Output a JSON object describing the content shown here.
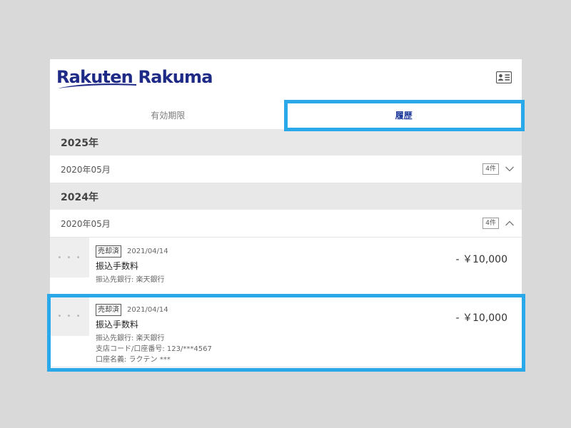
{
  "header": {
    "logo_text": "Rakuten Rakuma",
    "logo_brand_color": "#1e2a86",
    "id_card_icon": "id-card-icon"
  },
  "tabs": [
    {
      "label": "有効期限",
      "active": false
    },
    {
      "label": "履歴",
      "active": true
    }
  ],
  "groups": [
    {
      "year": "2025年",
      "months": [
        {
          "label": "2020年05月",
          "count": "4件",
          "expanded": false
        }
      ]
    },
    {
      "year": "2024年",
      "months": [
        {
          "label": "2020年05月",
          "count": "4件",
          "expanded": true,
          "items": [
            {
              "thumb": "• • •",
              "badge": "売却済",
              "date": "2021/04/14",
              "title": "振込手数料",
              "details": [
                "振込先銀行: 楽天銀行"
              ],
              "amount": "- ￥10,000"
            },
            {
              "thumb": "• • •",
              "badge": "売却済",
              "date": "2021/04/14",
              "title": "振込手数料",
              "details": [
                "振込先銀行: 楽天銀行",
                "支店コード/口座番号: 123/***4567",
                "口座名義: ラクテン ***"
              ],
              "amount": "- ￥10,000"
            }
          ]
        }
      ]
    }
  ],
  "highlight_color": "#29a9ea"
}
